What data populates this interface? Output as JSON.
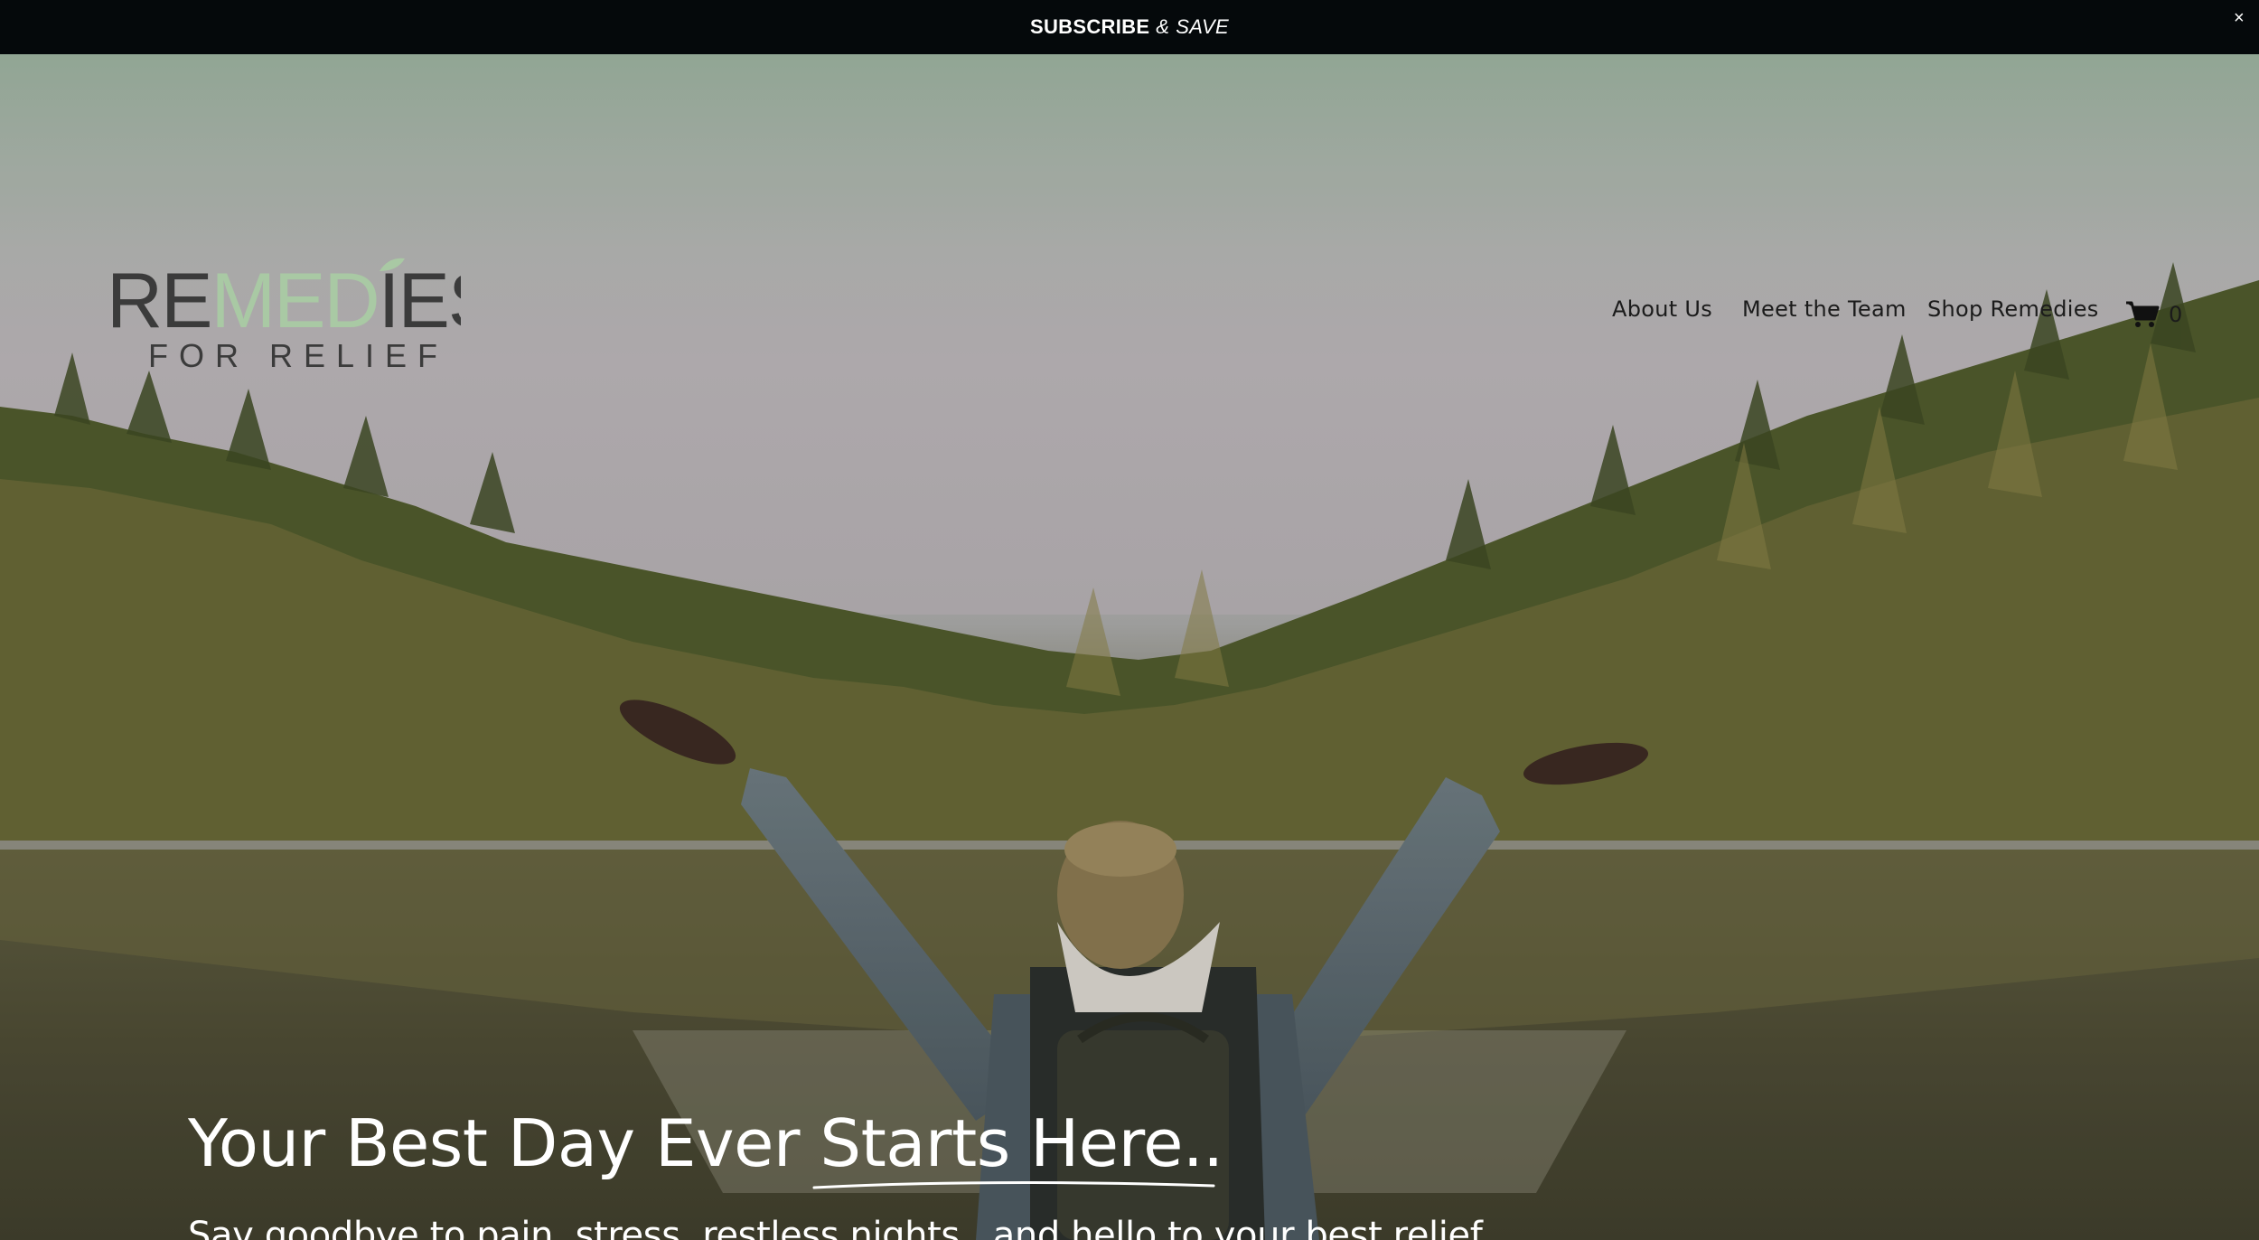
{
  "announcement": {
    "subscribe": "SUBSCRIBE",
    "amp": "&",
    "save": "SAVE",
    "close": "×"
  },
  "brand": {
    "logo_part1": "RE",
    "logo_part2": "MED",
    "logo_part3": "IES",
    "logo_tagline": "FOR RELIEF",
    "accent_color": "#a9c9a4",
    "dark_color": "#3b3b3b"
  },
  "nav": {
    "items": [
      {
        "label": "About Us"
      },
      {
        "label": "Meet the Team"
      },
      {
        "label": "Shop Remedies"
      }
    ],
    "cart_count": "0",
    "cart_icon": "cart-icon"
  },
  "hero": {
    "headline_part1": "Your Best Day Ever",
    "headline_part2": "Starts Here..",
    "subheadline": "Say goodbye to pain, stress, restless nights...and hello to your best relief."
  }
}
